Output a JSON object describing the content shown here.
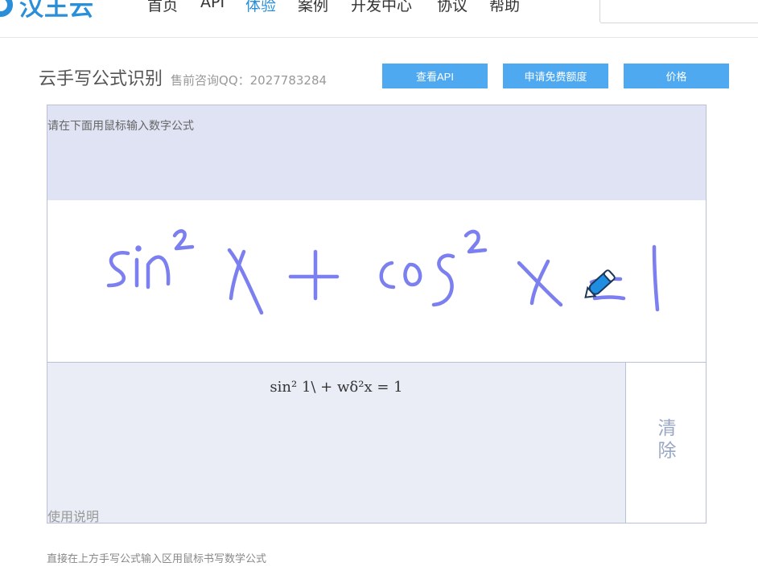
{
  "nav": {
    "logo_text": "汉王云",
    "items": [
      {
        "label": "首页",
        "active": false
      },
      {
        "label": "API",
        "active": false
      },
      {
        "label": "体验",
        "active": true
      },
      {
        "label": "案例",
        "active": false
      },
      {
        "label": "开发中心",
        "active": false
      },
      {
        "label": "协议",
        "active": false
      },
      {
        "label": "帮助",
        "active": false
      }
    ],
    "search_placeholder": ""
  },
  "header": {
    "title": "云手写公式识别",
    "subtitle": "售前咨询QQ：2027783284",
    "buttons": {
      "view_api": "查看API",
      "free_quota": "申请免费额度",
      "price": "价格"
    }
  },
  "input_area": {
    "hint": "请在下面用鼠标输入数字公式",
    "ink_color": "#7b7ff0",
    "cursor_icon": "pen-icon"
  },
  "result": {
    "formula": "sin² 1\\ + wδ²x = 1",
    "clear_label": "清除",
    "usage_title": "使用说明"
  },
  "usage_text": "直接在上方手写公式输入区用鼠标书写数学公式",
  "colors": {
    "brand": "#2a8fd8",
    "button": "#4fa9f0",
    "hint_bg": "#dfe3f3",
    "result_bg": "#eaedf6"
  }
}
